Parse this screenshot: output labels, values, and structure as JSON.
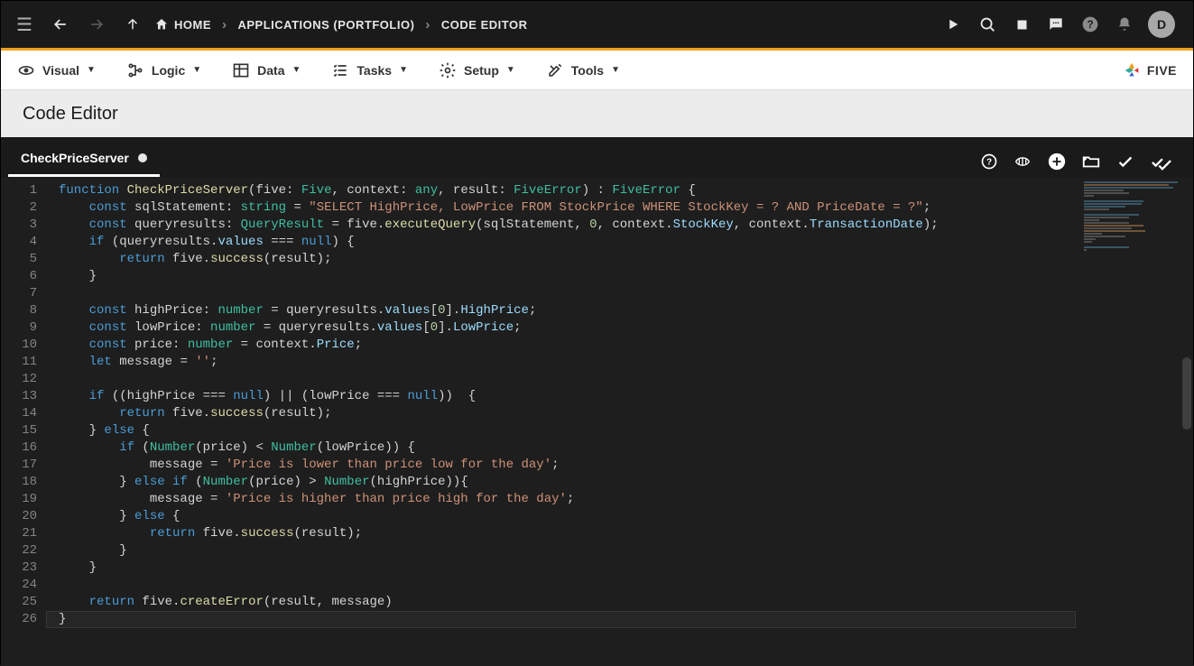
{
  "topbar": {
    "home_label": "HOME",
    "crumb1": "APPLICATIONS (PORTFOLIO)",
    "crumb2": "CODE EDITOR",
    "avatar_initial": "D"
  },
  "toolbar": {
    "visual": "Visual",
    "logic": "Logic",
    "data": "Data",
    "tasks": "Tasks",
    "setup": "Setup",
    "tools": "Tools",
    "brand": "FIVE"
  },
  "page": {
    "title": "Code Editor"
  },
  "tabs": {
    "active": "CheckPriceServer"
  },
  "code": {
    "lines": [
      "function CheckPriceServer(five: Five, context: any, result: FiveError) : FiveError {",
      "    const sqlStatement: string = \"SELECT HighPrice, LowPrice FROM StockPrice WHERE StockKey = ? AND PriceDate = ?\";",
      "    const queryresults: QueryResult = five.executeQuery(sqlStatement, 0, context.StockKey, context.TransactionDate);",
      "    if (queryresults.values === null) {",
      "        return five.success(result);",
      "    }",
      "",
      "    const highPrice: number = queryresults.values[0].HighPrice;",
      "    const lowPrice: number = queryresults.values[0].LowPrice;",
      "    const price: number = context.Price;",
      "    let message = '';",
      "",
      "    if ((highPrice === null) || (lowPrice === null))  {",
      "        return five.success(result);",
      "    } else {",
      "        if (Number(price) < Number(lowPrice)) {",
      "            message = 'Price is lower than price low for the day';",
      "        } else if (Number(price) > Number(highPrice)){",
      "            message = 'Price is higher than price high for the day';",
      "        } else {",
      "            return five.success(result);",
      "        }",
      "    }",
      "",
      "    return five.createError(result, message)",
      "}"
    ]
  }
}
